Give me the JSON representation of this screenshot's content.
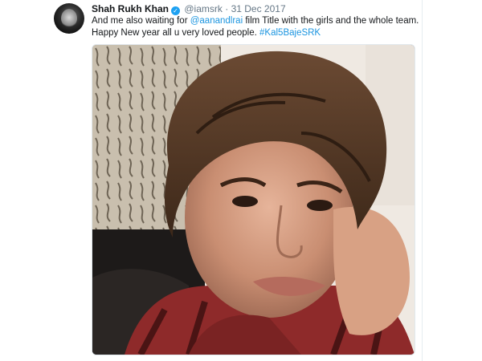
{
  "tweet": {
    "author_name": "Shah Rukh Khan",
    "handle": "@iamsrk",
    "separator": "·",
    "date": "31 Dec 2017",
    "verified_mark": "✓",
    "text_line1_prefix": "And me also waiting for ",
    "mention": "@aanandlrai",
    "text_line1_suffix": " film Title with the girls and the whole team.",
    "text_line2_prefix": "Happy New year all u very loved people. ",
    "hashtag": "#Kal5BajeSRK",
    "media_icon": "photo",
    "colors": {
      "link": "#1b95e0",
      "verified": "#1da1f2",
      "secondary_text": "#657786"
    }
  }
}
